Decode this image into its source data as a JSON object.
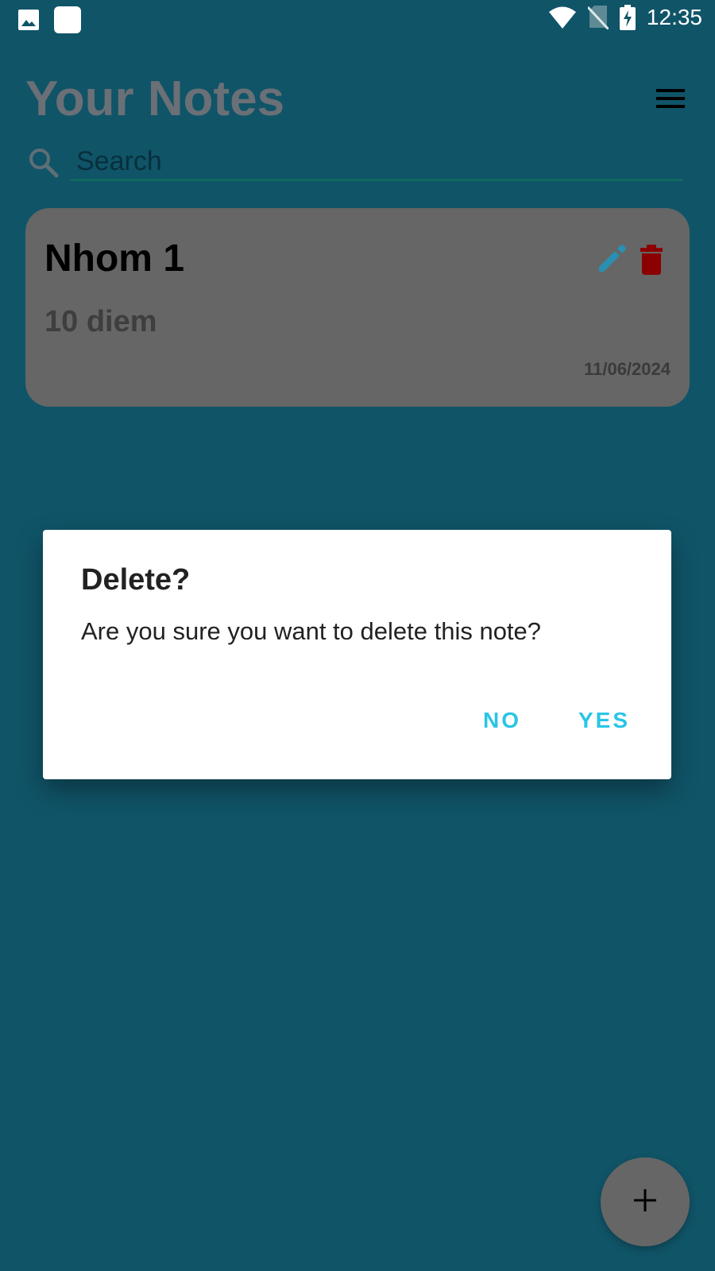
{
  "status_bar": {
    "time": "12:35",
    "icons": [
      "image-notification-icon",
      "app-notification-icon",
      "wifi-icon",
      "no-sim-icon",
      "battery-charging-icon"
    ]
  },
  "header": {
    "title": "Your Notes",
    "menu_icon": "hamburger-menu-icon"
  },
  "search": {
    "placeholder": "Search",
    "value": "",
    "icon": "search-icon"
  },
  "notes": [
    {
      "title": "Nhom 1",
      "content": "10 diem",
      "date": "11/06/2024",
      "actions": [
        "edit-icon",
        "delete-icon"
      ]
    }
  ],
  "dialog": {
    "title": "Delete?",
    "message": "Are you sure you want to delete this note?",
    "no_label": "NO",
    "yes_label": "YES"
  },
  "fab": {
    "icon": "plus-icon"
  },
  "colors": {
    "background": "#105468",
    "card": "#666666",
    "accent_button_text": "#29c5e6",
    "edit_icon": "#2a8fb0",
    "delete_icon": "#8b0000",
    "search_underline": "#0e6a5c"
  }
}
